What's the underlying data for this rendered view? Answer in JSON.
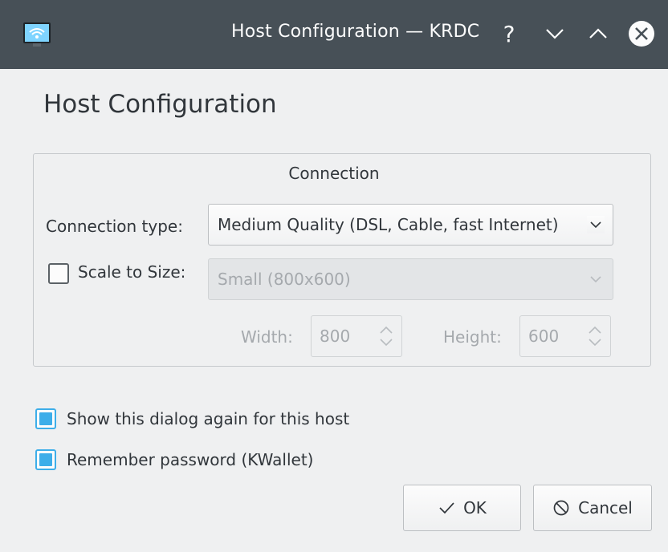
{
  "window": {
    "title": "Host Configuration — KRDC",
    "buttons": [
      "help",
      "minimize",
      "maximize",
      "close"
    ]
  },
  "dialog": {
    "heading": "Host Configuration",
    "group_title": "Connection",
    "connection_type": {
      "label": "Connection type:",
      "value": "Medium Quality (DSL, Cable, fast Internet)"
    },
    "scale": {
      "checked": false,
      "label": "Scale to Size:",
      "value": "Small (800x600)",
      "width_label": "Width:",
      "width_value": "800",
      "height_label": "Height:",
      "height_value": "600"
    },
    "options": {
      "show_again": {
        "checked": true,
        "label": "Show this dialog again for this host"
      },
      "remember": {
        "checked": true,
        "label": "Remember password (KWallet)"
      }
    },
    "ok_label": "OK",
    "cancel_label": "Cancel"
  },
  "colors": {
    "titlebar": "#475057",
    "accent": "#3daee9",
    "background": "#eff0f1"
  }
}
